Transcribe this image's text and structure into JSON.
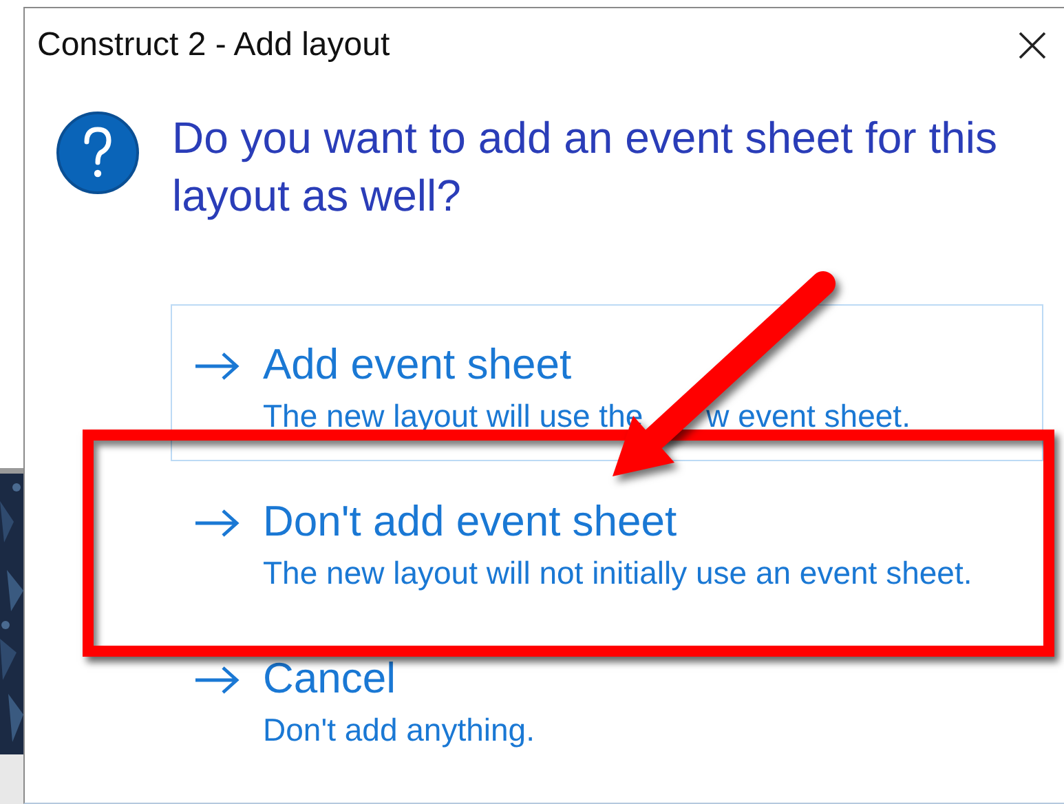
{
  "window": {
    "title": "Construct 2 - Add layout"
  },
  "question": "Do you want to add an event sheet for this layout as well?",
  "command_links": [
    {
      "title": "Add event sheet",
      "description": [
        "The new layout will use the",
        "w event sheet."
      ],
      "hovered": true,
      "annotated": false
    },
    {
      "title": "Don't add event sheet",
      "description": [
        "The new layout will not initially use an event sheet."
      ],
      "hovered": false,
      "annotated": true
    },
    {
      "title": "Cancel",
      "description": [
        "Don't add anything."
      ],
      "hovered": false,
      "annotated": false
    }
  ]
}
